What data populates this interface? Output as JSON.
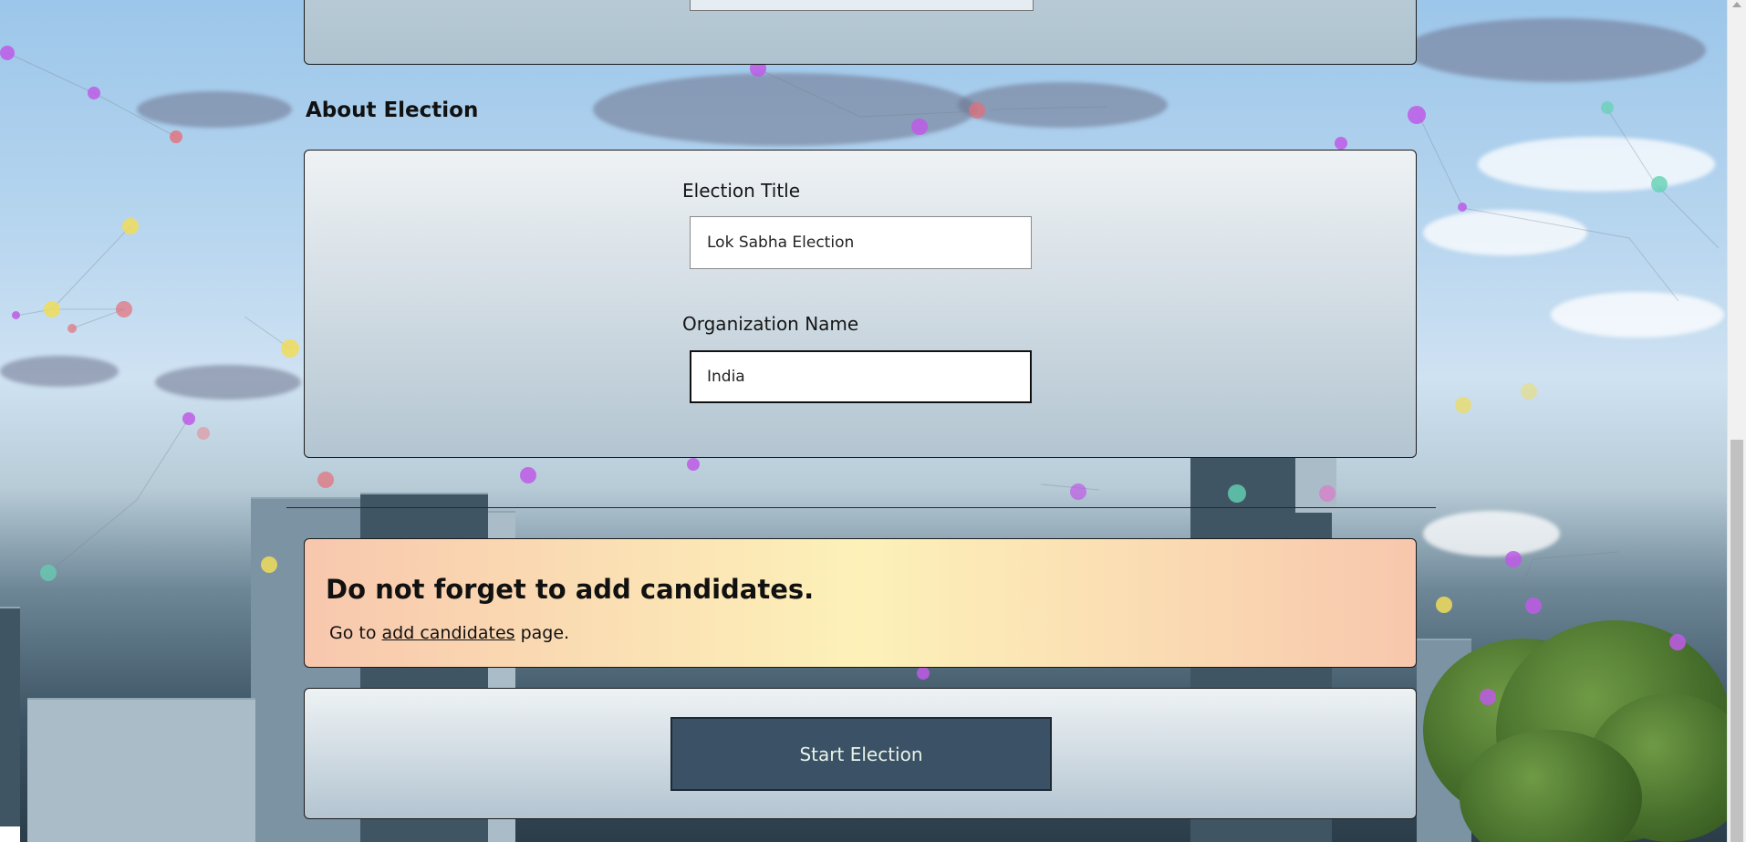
{
  "about_section": {
    "heading": "About Election",
    "election_title": {
      "label": "Election Title",
      "value": "Lok Sabha Election"
    },
    "organization_name": {
      "label": "Organization Name",
      "value": "India"
    }
  },
  "reminder": {
    "title": "Do not forget to add candidates.",
    "text_before": "Go to",
    "link_text": "add candidates",
    "text_after": "page."
  },
  "actions": {
    "start_label": "Start Election"
  },
  "colors": {
    "button_bg": "#3a5166",
    "button_text": "#e9f4e6",
    "reminder_left": "#f8c7ad",
    "reminder_center": "#fdf1b8"
  }
}
